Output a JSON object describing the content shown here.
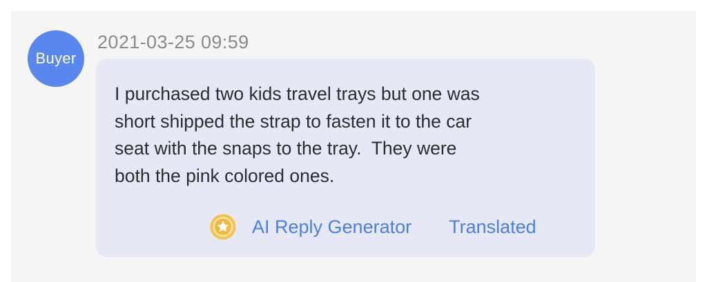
{
  "sender": {
    "avatar_label": "Buyer"
  },
  "message": {
    "timestamp": "2021-03-25 09:59",
    "text": "I purchased two kids travel trays but one was\nshort shipped the strap to fasten it to the car\nseat with the snaps to the tray.  They were\nboth the pink colored ones."
  },
  "actions": {
    "ai_icon": "gold-star-coin-icon",
    "ai_reply_label": "AI Reply Generator",
    "translated_label": "Translated"
  },
  "colors": {
    "avatar": "#5a87ee",
    "bubble": "#e6e9f5",
    "link": "#4a7fe0",
    "icon_gold": "#f3b73c"
  }
}
